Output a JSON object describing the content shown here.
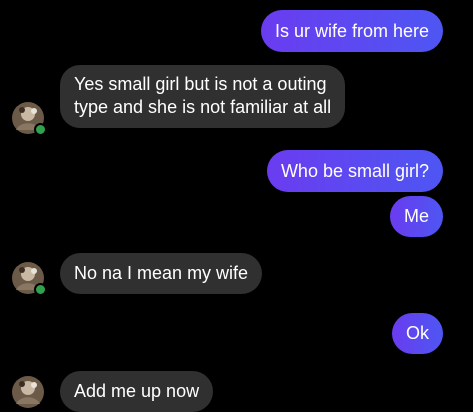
{
  "messages": [
    {
      "from": "me",
      "text": "Is ur wife from here"
    },
    {
      "from": "them",
      "lines": [
        "Yes small girl but is not a outing",
        "type and she is not familiar at all"
      ]
    },
    {
      "from": "me",
      "text": "Who be small girl?"
    },
    {
      "from": "me",
      "text": "Me"
    },
    {
      "from": "them",
      "text": "No na I mean my wife"
    },
    {
      "from": "me",
      "text": "Ok"
    },
    {
      "from": "them",
      "text": "Add me up now"
    }
  ],
  "colors": {
    "background": "#000000",
    "sent_bubble": "#5a48f1",
    "received_bubble": "#303030",
    "presence_dot": "#31a24c"
  },
  "icons": {
    "avatar": "contact-avatar",
    "presence": "online-presence-dot"
  }
}
